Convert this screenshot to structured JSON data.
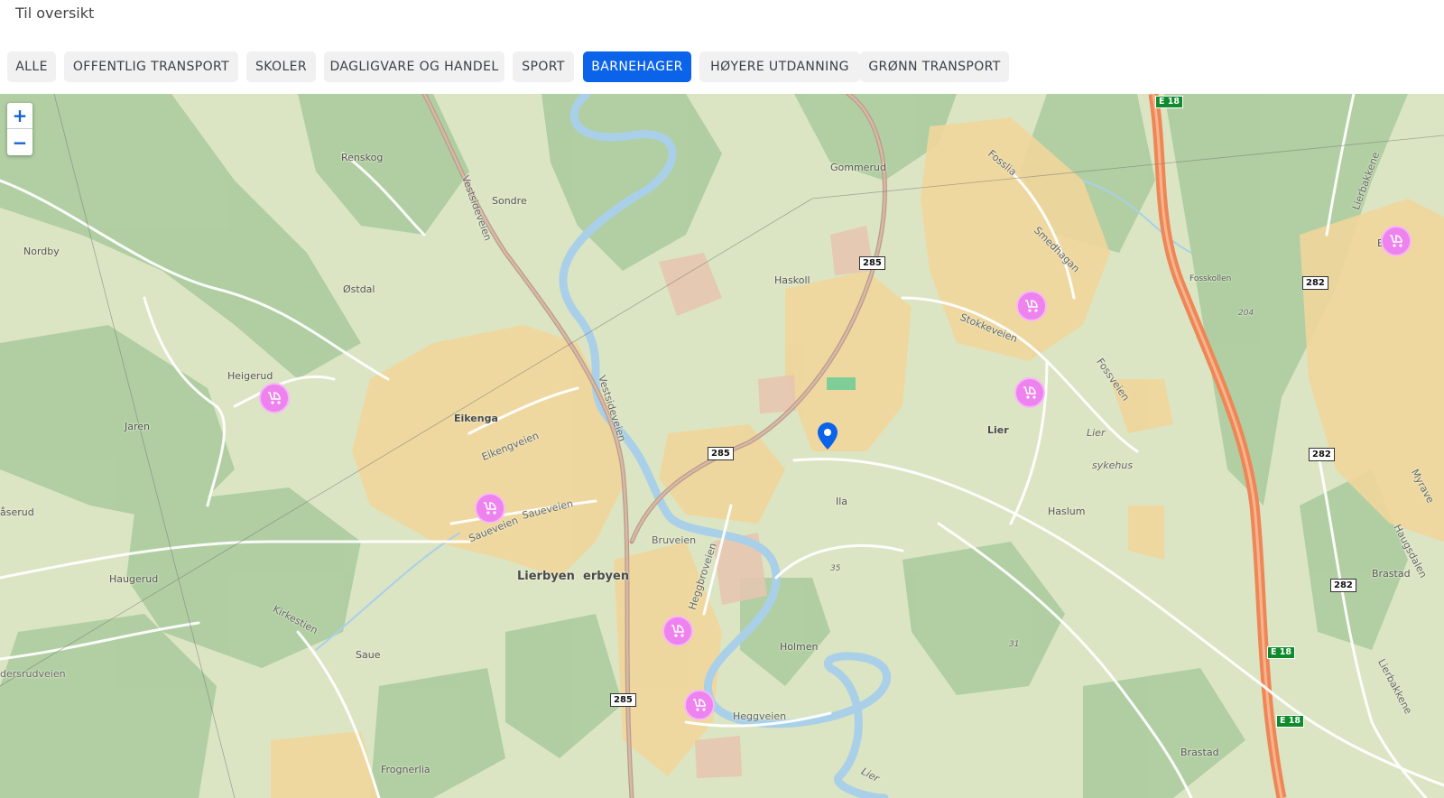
{
  "header": {
    "back_label": "Til oversikt"
  },
  "filters": [
    {
      "label": "ALLE",
      "active": false
    },
    {
      "label": "OFFENTLIG TRANSPORT",
      "active": false
    },
    {
      "label": "SKOLER",
      "active": false
    },
    {
      "label": "DAGLIGVARE OG HANDEL",
      "active": false
    },
    {
      "label": "SPORT",
      "active": false
    },
    {
      "label": "BARNEHAGER",
      "active": true
    },
    {
      "label": "HØYERE UTDANNING",
      "active": false
    },
    {
      "label": "GRØNN TRANSPORT",
      "active": false
    }
  ],
  "colors": {
    "accent": "#0a63e8",
    "marker": "#ee82ee",
    "pin": "#0a63e8",
    "highway": "#ef8658",
    "river": "#a9d0e8"
  },
  "map": {
    "zoom_in_label": "+",
    "zoom_out_label": "−",
    "places": {
      "renskog": "Renskog",
      "sondre": "Sondre",
      "nordby": "Nordby",
      "ostdal": "Østdal",
      "heigerud": "Heigerud",
      "jaren": "Jaren",
      "saserud": "åserud",
      "haugerud": "Haugerud",
      "kirkestien": "Kirkestien",
      "saue": "Saue",
      "dersrudveien": "dersrudveien",
      "frognerlia": "Frognerlia",
      "eikenga": "Eikenga",
      "eikengveien": "Eikengveien",
      "saueveien1": "Saueveien",
      "saueveien2": "Saueveien",
      "lierbyen": "Lierbyen",
      "lierbyen2": "erbyen",
      "bruveien": "Bruveien",
      "heggbroveien": "Heggbroveien",
      "holmen": "Holmen",
      "heggveien": "Heggveien",
      "vestsideveien1": "Vestsideveien",
      "vestsideveien2": "Vestsideveien",
      "gommerud": "Gommerud",
      "haskoll": "Haskoll",
      "ila": "Ila",
      "lier": "Lier",
      "lier_it": "Lier",
      "sykehus": "sykehus",
      "haslum": "Haslum",
      "fosslia": "Fosslia",
      "smedhagan": "Smedhagan",
      "stokkeveien": "Stokkeveien",
      "fossveien": "Fossveien",
      "fosskollen": "Fosskollen",
      "brastad1": "Brastad",
      "brastad2": "Brastad",
      "haugsdalen": "Haugsdalen",
      "myrave": "Myrave",
      "lierbakkene1": "Lierbakkene",
      "lierbakkene2": "Lierbakkene",
      "bra": "Bra",
      "n35": "35",
      "n31": "31",
      "n204": "204",
      "lier_river": "Lier"
    },
    "road_shields": {
      "r285a": "285",
      "r285b": "285",
      "r285c": "285",
      "r282a": "282",
      "r282b": "282",
      "r282c": "282"
    },
    "e_shields": {
      "e18a": "E 18",
      "e18b": "E 18",
      "e18c": "E 18"
    },
    "kindergarten_markers": [
      "barnehage",
      "barnehage",
      "barnehage",
      "barnehage",
      "barnehage",
      "barnehage",
      "barnehage"
    ],
    "location_pin": "location-pin"
  }
}
